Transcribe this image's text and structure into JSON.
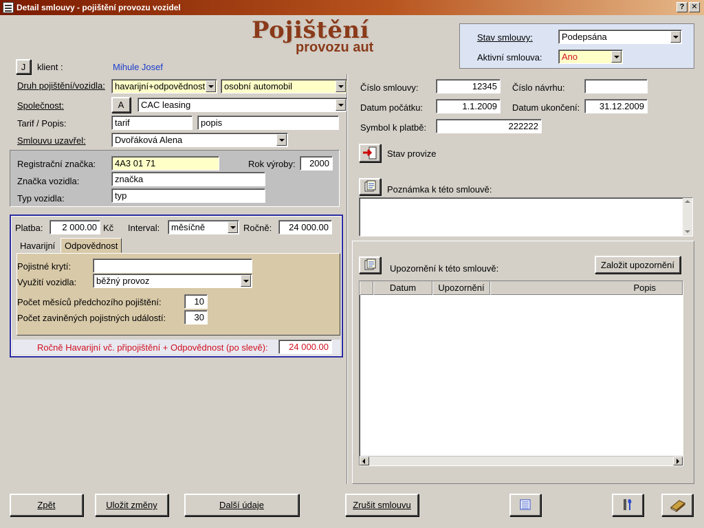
{
  "window": {
    "title": "Detail smlouvy - pojištění provozu vozidel",
    "help_btn": "?",
    "close_btn": "✕"
  },
  "logo": {
    "line1": "Pojištění",
    "line2": "provozu aut"
  },
  "status": {
    "stav_label": "Stav smlouvy:",
    "stav_value": "Podepsána",
    "aktivni_label": "Aktivní smlouva:",
    "aktivni_value": "Ano"
  },
  "client": {
    "button": "J",
    "label": "klient :",
    "name": "Mihule  Josef"
  },
  "contract": {
    "druh_label": "Druh pojištění/vozidla:",
    "druh_value": "havarijní+odpovědnost",
    "vozidlo_value": "osobní automobil",
    "spolecnost_label": "Společnost:",
    "spolecnost_button": "A",
    "spolecnost_value": "CAC leasing",
    "tarif_label": "Tarif / Popis:",
    "tarif_value": "tarif",
    "popis_value": "popis",
    "uzavrel_label": "Smlouvu uzavřel:",
    "uzavrel_value": "Dvořáková Alena"
  },
  "vehicle": {
    "spz_label": "Registrační značka:",
    "spz_value": "4A3 01 71",
    "rok_label": "Rok výroby:",
    "rok_value": "2000",
    "znacka_label": "Značka vozidla:",
    "znacka_value": "značka",
    "typ_label": "Typ vozidla:",
    "typ_value": "typ"
  },
  "payment": {
    "platba_label": "Platba:",
    "platba_value": "2 000.00",
    "currency": "Kč",
    "interval_label": "Interval:",
    "interval_value": "měsíčně",
    "rocne_label": "Ročně:",
    "rocne_value": "24 000.00",
    "tabs": [
      "Havarijní",
      "Odpovědnost"
    ],
    "kryti_label": "Pojistné krytí:",
    "kryti_value": "",
    "vyuziti_label": "Využití vozidla:",
    "vyuziti_value": "běžný provoz",
    "mesicu_label": "Počet měsíců předchozího pojištění:",
    "mesicu_value": "10",
    "udalosti_label": "Počet zaviněných pojistných událostí:",
    "udalosti_value": "30",
    "total_label": "Ročně Havarijní vč. připojištění + Odpovědnost (po slevě):",
    "total_value": "24 000.00"
  },
  "details": {
    "cislo_label": "Číslo smlouvy:",
    "cislo_value": "12345",
    "navrh_label": "Číslo návrhu:",
    "navrh_value": "",
    "pocatek_label": "Datum počátku:",
    "pocatek_value": "1.1.2009",
    "ukonceni_label": "Datum ukončení:",
    "ukonceni_value": "31.12.2009",
    "symbol_label": "Symbol k platbě:",
    "symbol_value": "222222",
    "provize_label": "Stav provize",
    "poznamka_label": "Poznámka k této smlouvě:"
  },
  "alerts": {
    "label": "Upozornění k této smlouvě:",
    "add_button": "Založit upozornění",
    "columns": [
      "Datum",
      "Upozornění",
      "Popis"
    ]
  },
  "footer": {
    "back": "Zpět",
    "save": "Uložit změny",
    "more": "Další údaje",
    "cancel": "Zrušit smlouvu"
  },
  "colors": {
    "accent_blue": "#2a2aa0",
    "client_blue": "#1a3cc8",
    "warning_red": "#d01020",
    "highlight_yellow": "#ffffc8"
  }
}
